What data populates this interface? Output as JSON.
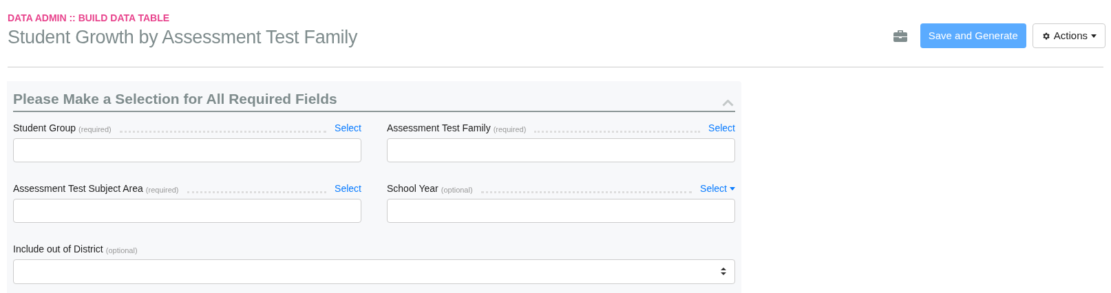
{
  "breadcrumb": "DATA ADMIN :: BUILD DATA TABLE",
  "title": "Student Growth by Assessment Test Family",
  "toolbar": {
    "save_button": "Save and Generate",
    "actions_button": "Actions"
  },
  "panel": {
    "title": "Please Make a Selection for All Required Fields",
    "expanded": true,
    "fields": [
      {
        "kind": "picker",
        "label": "Student Group",
        "note": "(required)",
        "action": "Select",
        "dropdown": false
      },
      {
        "kind": "picker",
        "label": "Assessment Test Family",
        "note": "(required)",
        "action": "Select",
        "dropdown": false
      },
      {
        "kind": "picker",
        "label": "Assessment Test Subject Area",
        "note": "(required)",
        "action": "Select",
        "dropdown": false
      },
      {
        "kind": "picker",
        "label": "School Year",
        "note": "(optional)",
        "action": "Select",
        "dropdown": true
      },
      {
        "kind": "select",
        "label": "Include out of District",
        "note": "(optional)"
      }
    ]
  }
}
